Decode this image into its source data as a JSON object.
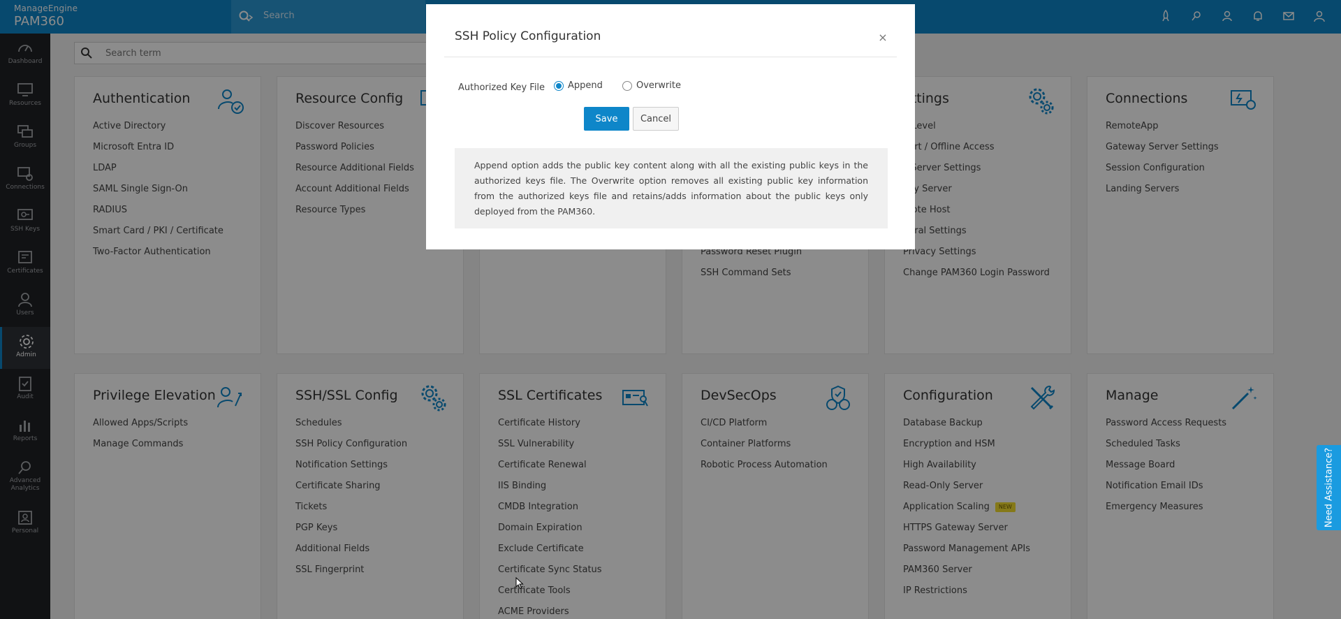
{
  "brand": {
    "line1": "ManageEngine",
    "line2": "PAM360"
  },
  "topbar": {
    "search_placeholder": "Search",
    "icons": [
      "rocket-icon",
      "key-link-icon",
      "user-key-icon",
      "bell-icon",
      "mail-icon",
      "user-icon"
    ]
  },
  "sidebar": [
    {
      "label": "Dashboard",
      "icon": "dashboard-icon"
    },
    {
      "label": "Resources",
      "icon": "monitor-icon"
    },
    {
      "label": "Groups",
      "icon": "groups-icon"
    },
    {
      "label": "Connections",
      "icon": "connections-icon"
    },
    {
      "label": "SSH Keys",
      "icon": "ssh-keys-icon"
    },
    {
      "label": "Certificates",
      "icon": "certificate-icon"
    },
    {
      "label": "Users",
      "icon": "user-icon"
    },
    {
      "label": "Admin",
      "icon": "gear-icon",
      "active": true
    },
    {
      "label": "Audit",
      "icon": "clipboard-icon"
    },
    {
      "label": "Reports",
      "icon": "bar-chart-icon"
    },
    {
      "label": "Advanced Analytics",
      "icon": "analytics-icon"
    },
    {
      "label": "Personal",
      "icon": "personal-icon"
    }
  ],
  "page_search": {
    "placeholder": "Search term"
  },
  "cards_row1": [
    {
      "title": "Authentication",
      "icon": "user-check-icon",
      "items": [
        "Active Directory",
        "Microsoft Entra ID",
        "LDAP",
        "SAML Single Sign-On",
        "RADIUS",
        "Smart Card / PKI / Certificate",
        "Two-Factor Authentication"
      ]
    },
    {
      "title": "Resource Config",
      "icon": "monitor-gear-icon",
      "items": [
        "Discover Resources",
        "Password Policies",
        "Resource Additional Fields",
        "Account Additional Fields",
        "Resource Types"
      ]
    },
    {
      "title": "",
      "icon": "",
      "items": []
    },
    {
      "title": "",
      "icon": "",
      "items": [
        "Password Reset Plugin",
        "SSH Command Sets"
      ]
    },
    {
      "title": "ettings",
      "icon": "gears-icon",
      "items": [
        "g Level",
        "port / Offline Access",
        "il Server Settings",
        "oxy Server",
        "mote Host",
        "neral Settings",
        "Privacy Settings",
        "Change PAM360 Login Password"
      ]
    },
    {
      "title": "Connections",
      "icon": "connection-gear-icon",
      "items": [
        "RemoteApp",
        "Gateway Server Settings",
        "Session Configuration",
        "Landing Servers"
      ]
    }
  ],
  "cards_row2": [
    {
      "title": "Privilege Elevation",
      "icon": "user-elevate-icon",
      "items": [
        "Allowed Apps/Scripts",
        "Manage Commands"
      ]
    },
    {
      "title": "SSH/SSL Config",
      "icon": "gears-icon",
      "items": [
        "Schedules",
        "SSH Policy Configuration",
        "Notification Settings",
        "Certificate Sharing",
        "Tickets",
        "PGP Keys",
        "Additional Fields",
        "SSL Fingerprint"
      ]
    },
    {
      "title": "SSL Certificates",
      "icon": "id-card-key-icon",
      "items": [
        "Certificate History",
        "SSL Vulnerability",
        "Certificate Renewal",
        "IIS Binding",
        "CMDB Integration",
        "Domain Expiration",
        "Exclude Certificate",
        "Certificate Sync Status",
        "Certificate Tools",
        "ACME Providers"
      ]
    },
    {
      "title": "DevSecOps",
      "icon": "devsecops-icon",
      "items": [
        "CI/CD Platform",
        "Container Platforms",
        "Robotic Process Automation"
      ]
    },
    {
      "title": "Configuration",
      "icon": "tools-icon",
      "items": [
        "Database Backup",
        "Encryption and HSM",
        "High Availability",
        "Read-Only Server",
        "Application Scaling",
        "HTTPS Gateway Server",
        "Password Management APIs",
        "PAM360 Server",
        "IP Restrictions"
      ],
      "badge": "NEW"
    },
    {
      "title": "Manage",
      "icon": "magic-wand-icon",
      "items": [
        "Password Access Requests",
        "Scheduled Tasks",
        "Message Board",
        "Notification Email IDs",
        "Emergency Measures"
      ]
    }
  ],
  "modal": {
    "title": "SSH Policy Configuration",
    "close": "×",
    "field_label": "Authorized Key File",
    "options": [
      {
        "label": "Append",
        "checked": true
      },
      {
        "label": "Overwrite",
        "checked": false
      }
    ],
    "save": "Save",
    "cancel": "Cancel",
    "info": "Append option adds the public key content along with all the existing public keys in the authorized keys file. The Overwrite option removes all existing public key information from the authorized keys file and retains/adds information about the public keys only deployed from the PAM360."
  },
  "assist": "Need Assistance?",
  "colors": {
    "primary": "#0e86c9",
    "sidebar": "#1f2126",
    "badge": "#f3dd2f"
  }
}
